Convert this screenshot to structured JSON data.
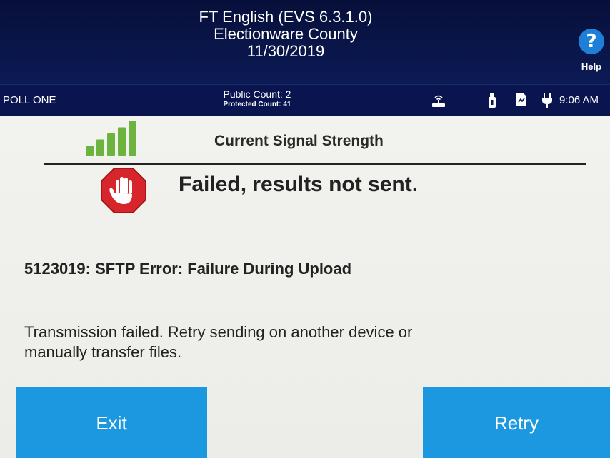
{
  "header": {
    "title_line1": "FT English (EVS 6.3.1.0)",
    "title_line2": "Electionware County",
    "title_line3": "11/30/2019",
    "help_symbol": "?",
    "help_label": "Help"
  },
  "status_bar": {
    "poll_name": "POLL ONE",
    "public_count": "Public Count: 2",
    "protected_count": "Protected Count: 41",
    "icons": [
      "modem-icon",
      "usb-icon",
      "document-icon",
      "power-plug-icon"
    ],
    "time": "9:06 AM"
  },
  "signal": {
    "label": "Current Signal Strength",
    "bars_lit": 5,
    "bars_total": 5
  },
  "result": {
    "title": "Failed, results not sent.",
    "error_code_line": "5123019: SFTP Error: Failure During Upload",
    "message_line1": "Transmission failed.  Retry sending on another device or",
    "message_line2": "manually transfer files."
  },
  "buttons": {
    "exit_label": "Exit",
    "retry_label": "Retry"
  },
  "colors": {
    "header_bg": "#0c1a55",
    "help_blue": "#1e7fd8",
    "button_blue": "#1b98e0",
    "signal_green": "#6db33f",
    "stop_red": "#d7262b"
  }
}
